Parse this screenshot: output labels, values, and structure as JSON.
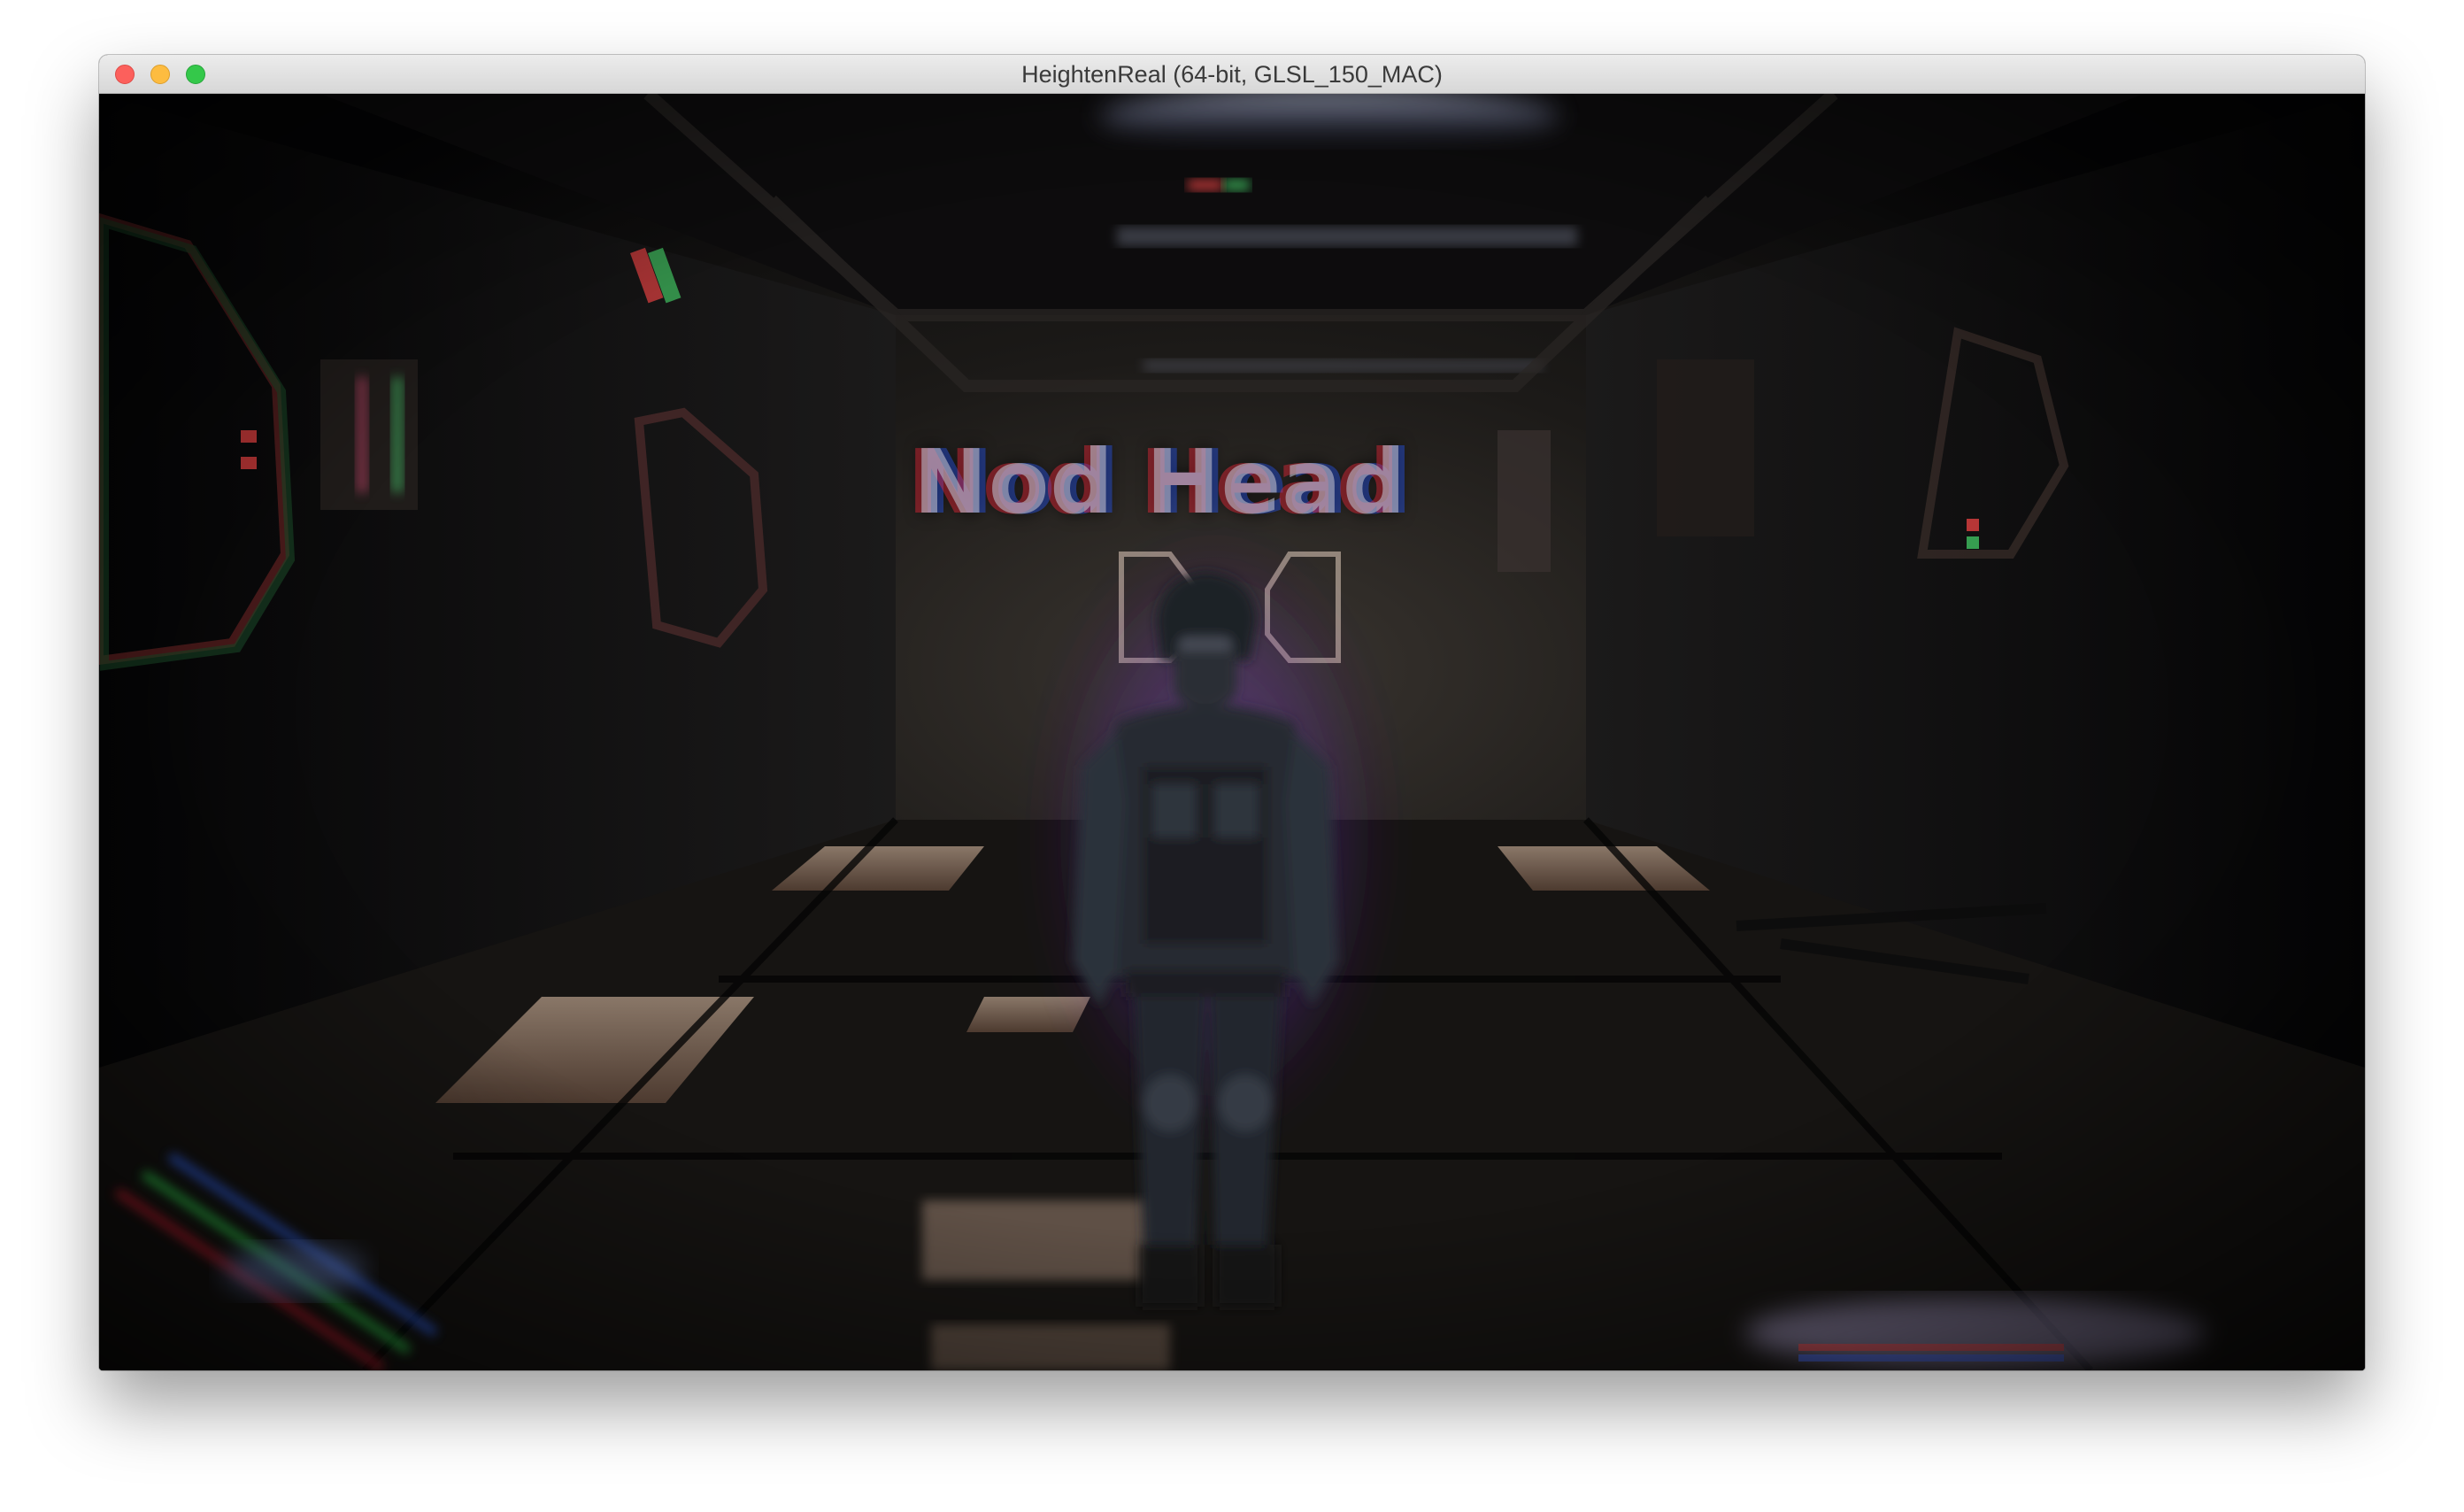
{
  "window": {
    "title": "HeightenReal (64-bit, GLSL_150_MAC)",
    "buttons": {
      "close": "close-icon",
      "minimize": "minimize-icon",
      "zoom": "zoom-icon"
    }
  },
  "scene": {
    "hud_label": "Nod Head",
    "colors": {
      "background": "#050506",
      "aura": "#8a4ad8",
      "floor_light": "#d9b9a0",
      "ceiling_light": "#c9d6ff"
    }
  }
}
